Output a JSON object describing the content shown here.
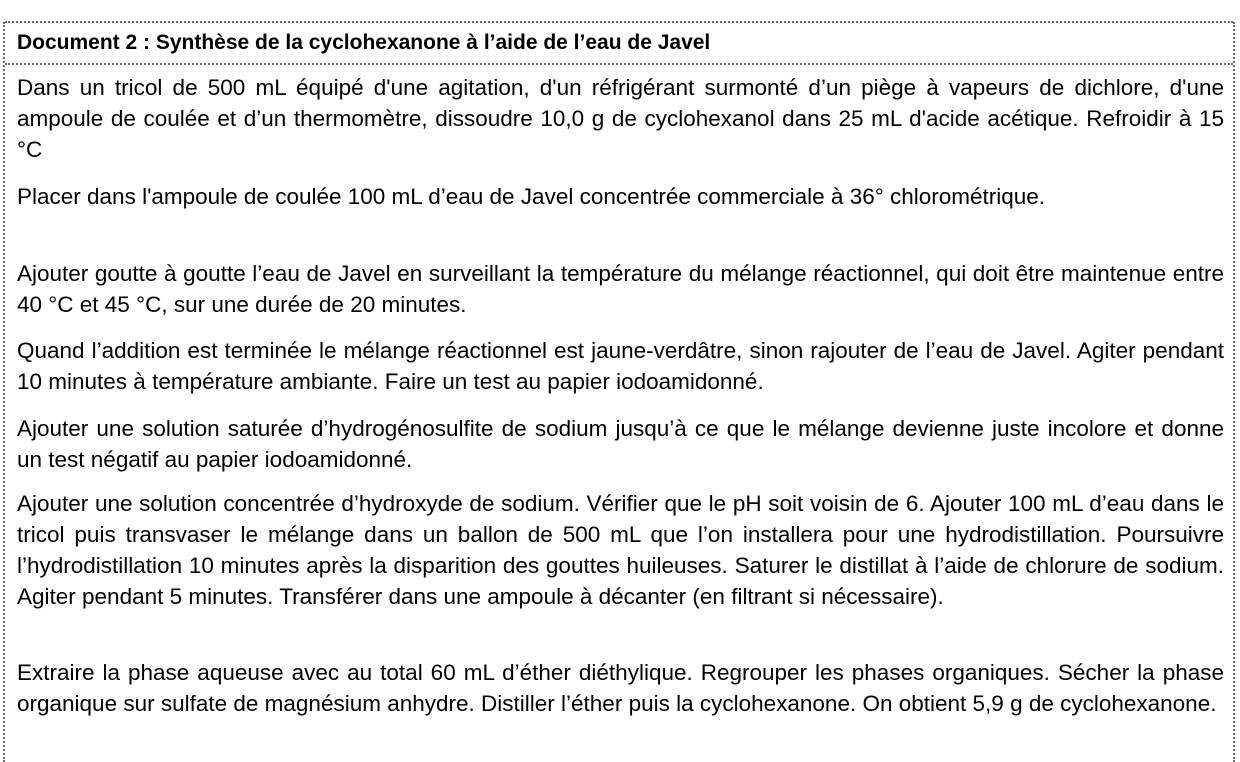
{
  "document": {
    "title": "Document 2 : Synthèse de la cyclohexanone à l’aide de l’eau de Javel",
    "paragraphs": [
      "Dans un tricol de 500 mL équipé d'une agitation, d'un réfrigérant surmonté d’un piège à vapeurs de dichlore, d'une ampoule de coulée et d’un thermomètre, dissoudre 10,0 g de cyclohexanol dans 25 mL d'acide acétique. Refroidir à 15 °C",
      "Placer dans l'ampoule de coulée 100 mL d’eau de Javel concentrée commerciale à 36° chlorométrique.",
      "Ajouter goutte à goutte l’eau de Javel en surveillant la température du mélange réactionnel, qui doit être maintenue entre 40 °C et 45 °C, sur une durée de 20 minutes.",
      "Quand l’addition est terminée le mélange réactionnel est jaune-verdâtre, sinon rajouter de l’eau de Javel. Agiter pendant 10 minutes à température ambiante. Faire un test au papier iodoamidonné.",
      "Ajouter une solution saturée d’hydrogénosulfite de sodium jusqu’à ce que le mélange devienne juste incolore et donne un test négatif au papier iodoamidonné.",
      "Ajouter une solution concentrée d’hydroxyde de sodium. Vérifier que le pH soit voisin de 6. Ajouter 100 mL d’eau dans le tricol puis transvaser le mélange dans un ballon de 500 mL que l’on installera pour une hydrodistillation. Poursuivre l’hydrodistillation 10 minutes après la disparition des gouttes huileuses. Saturer le distillat à l’aide de chlorure de sodium. Agiter pendant 5 minutes. Transférer dans une ampoule à décanter (en filtrant si nécessaire).",
      "Extraire la phase aqueuse avec au total 60 mL d’éther diéthylique. Regrouper les phases organiques. Sécher la phase organique sur sulfate de magnésium anhydre. Distiller l’éther puis la cyclohexanone. On obtient 5,9 g de cyclohexanone."
    ]
  }
}
